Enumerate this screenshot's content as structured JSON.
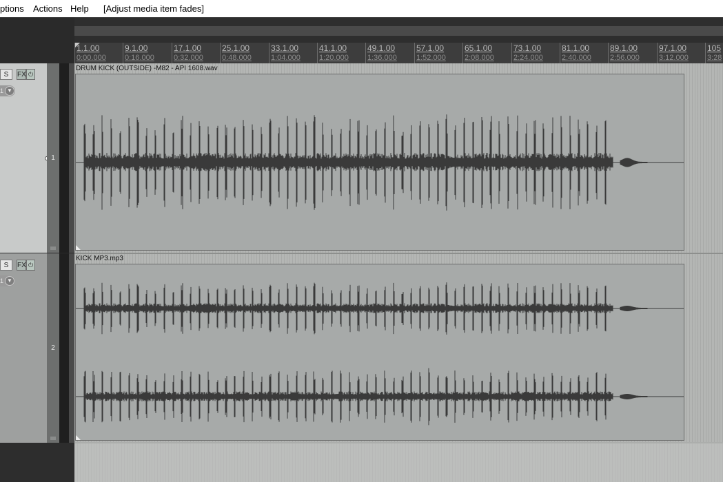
{
  "menu": {
    "items": [
      "ptions",
      "Actions",
      "Help"
    ],
    "status": "[Adjust media item fades]"
  },
  "ruler": {
    "markers": [
      {
        "measure": "1.1.00",
        "time": "0:00.000"
      },
      {
        "measure": "9.1.00",
        "time": "0:16.000"
      },
      {
        "measure": "17.1.00",
        "time": "0:32.000"
      },
      {
        "measure": "25.1.00",
        "time": "0:48.000"
      },
      {
        "measure": "33.1.00",
        "time": "1:04.000"
      },
      {
        "measure": "41.1.00",
        "time": "1:20.000"
      },
      {
        "measure": "49.1.00",
        "time": "1:36.000"
      },
      {
        "measure": "57.1.00",
        "time": "1:52.000"
      },
      {
        "measure": "65.1.00",
        "time": "2:08.000"
      },
      {
        "measure": "73.1.00",
        "time": "2:24.000"
      },
      {
        "measure": "81.1.00",
        "time": "2:40.000"
      },
      {
        "measure": "89.1.00",
        "time": "2:56.000"
      },
      {
        "measure": "97.1.00",
        "time": "3:12.000"
      },
      {
        "measure": "105",
        "time": "3:28"
      }
    ]
  },
  "tracks": [
    {
      "number": "1",
      "solo_label": "S",
      "fx_label": "FX",
      "power_label": "⏻",
      "pan_label": "1",
      "item_name": "DRUM KICK (OUTSIDE) -M82 - API 1608.wav",
      "channels": 1,
      "waveform_color": "#3a3a3a"
    },
    {
      "number": "2",
      "solo_label": "S",
      "fx_label": "FX",
      "power_label": "⏻",
      "pan_label": "1",
      "item_name": "KICK MP3.mp3",
      "channels": 2,
      "waveform_color": "#3a3a3a"
    }
  ],
  "colors": {
    "tcp_selected": "#c8cac9",
    "tcp_normal": "#9ea09f",
    "item_bg": "#a7aaa9",
    "arrange_bg": "#b4b6b4"
  }
}
